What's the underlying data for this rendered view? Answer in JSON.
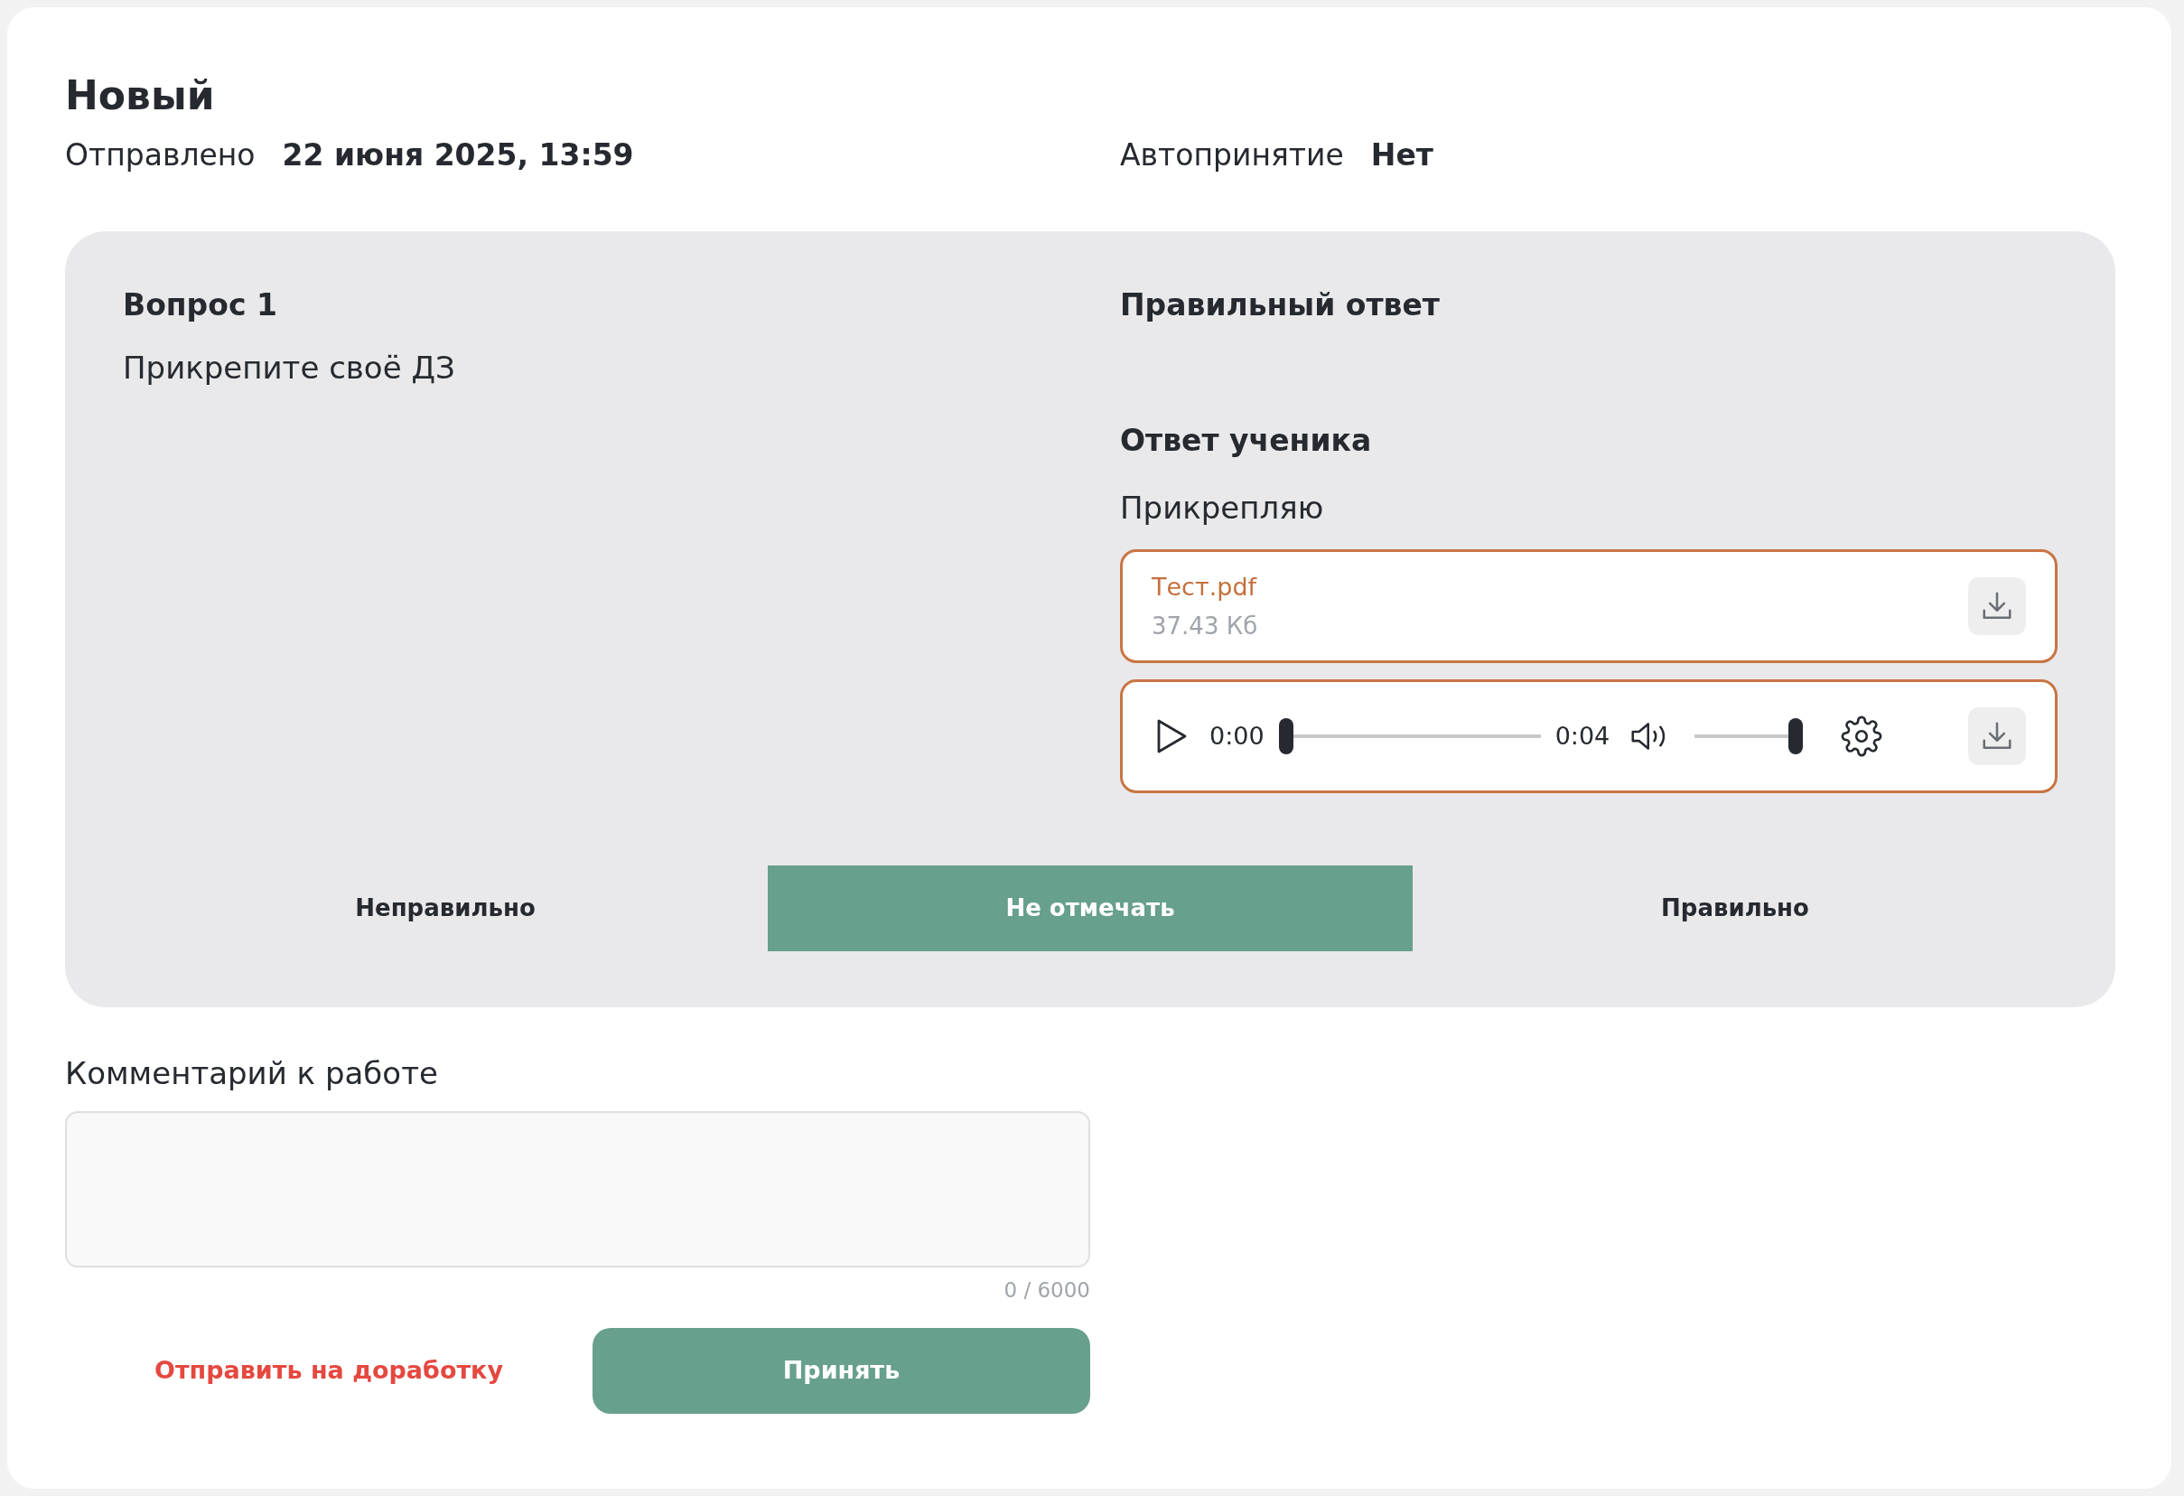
{
  "header": {
    "status": "Новый",
    "sent_label": "Отправлено",
    "sent_value": "22 июня 2025, 13:59",
    "auto_label": "Автопринятие",
    "auto_value": "Нет"
  },
  "question": {
    "title": "Вопрос 1",
    "text": "Прикрепите своё ДЗ"
  },
  "correct_answer": {
    "title": "Правильный ответ"
  },
  "student_answer": {
    "title": "Ответ ученика",
    "text": "Прикрепляю",
    "attachments": [
      {
        "kind": "file",
        "name": "Тест.pdf",
        "size": "37.43 Кб"
      },
      {
        "kind": "audio",
        "current_time": "0:00",
        "duration": "0:04",
        "progress": {
          "level": 0
        },
        "volume": {
          "level": 1
        }
      }
    ]
  },
  "marks": [
    {
      "label": "Неправильно",
      "selected": false
    },
    {
      "label": "Не отмечать",
      "selected": true
    },
    {
      "label": "Правильно",
      "selected": false
    }
  ],
  "comment": {
    "label": "Комментарий к работе",
    "counter": "0 / 6000"
  },
  "actions": [
    {
      "kind": "link",
      "label": "Отправить на доработку"
    },
    {
      "kind": "primary",
      "label": "Принять"
    }
  ]
}
